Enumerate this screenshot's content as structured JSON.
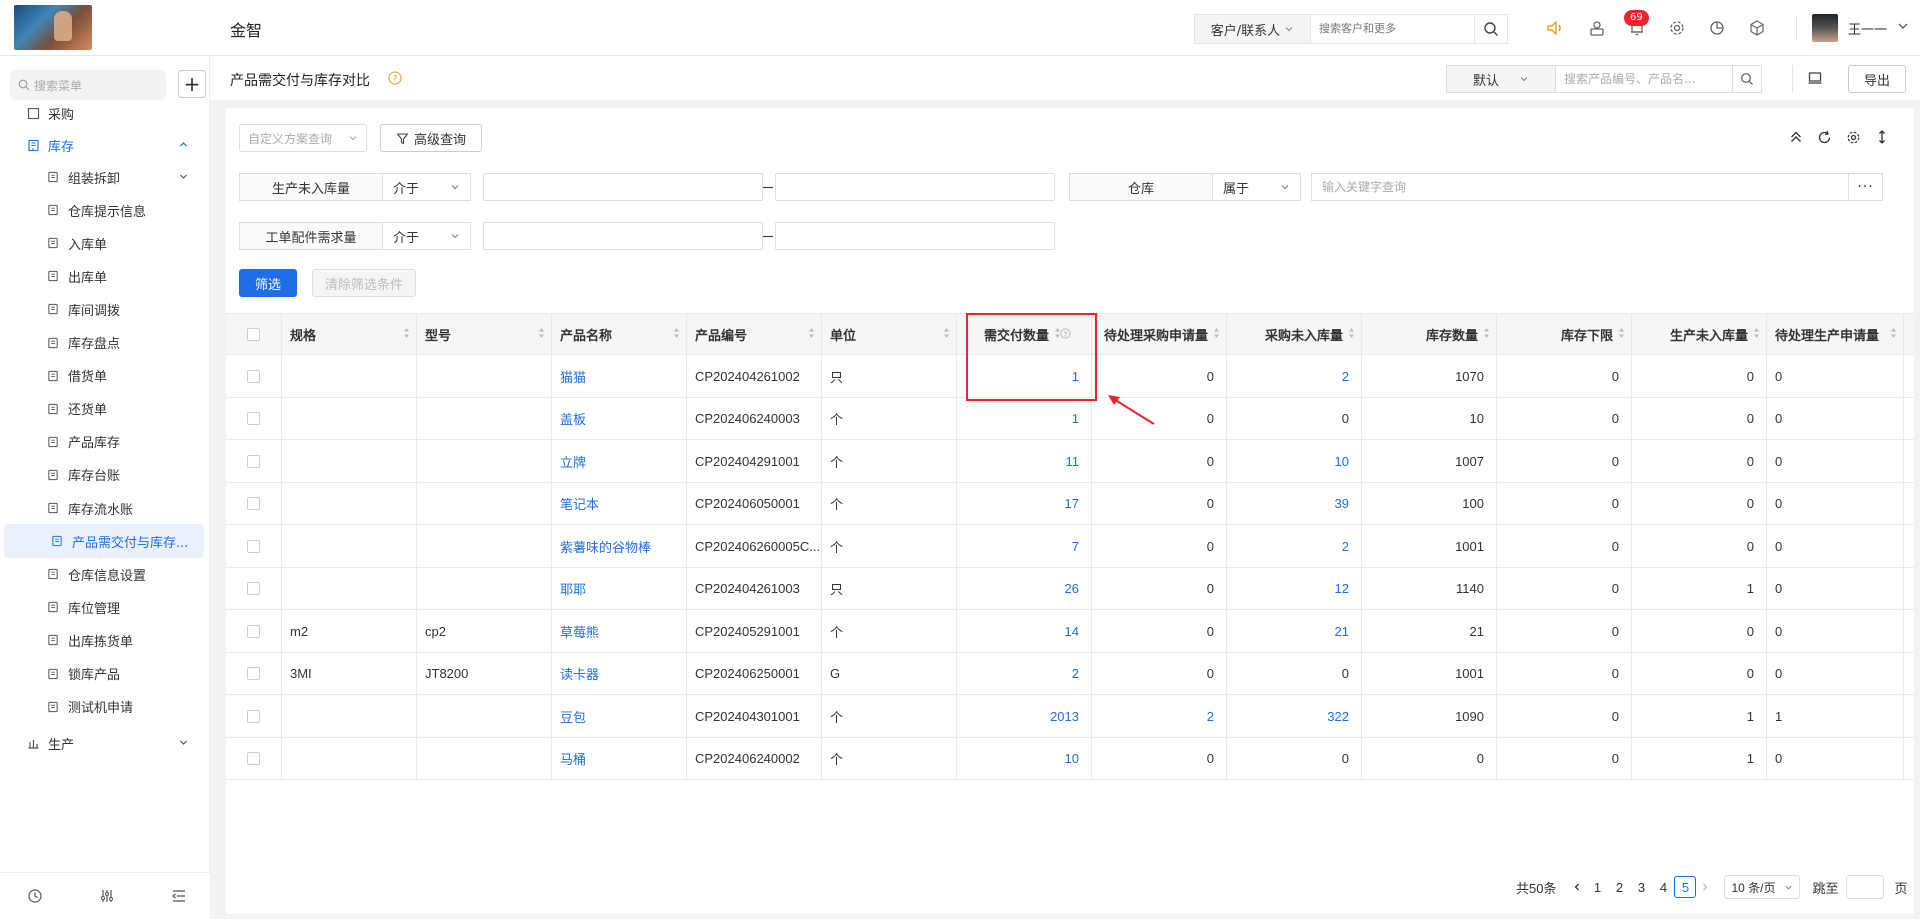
{
  "header": {
    "app_title": "金智",
    "customer_select": "客户/联系人",
    "customer_search_placeholder": "搜索客户和更多",
    "notification_count": "69",
    "user_name": "王一一"
  },
  "sidebar": {
    "search_placeholder": "搜索菜单",
    "partial_top": "采购",
    "section": "库存",
    "items": [
      {
        "label": "组装拆卸",
        "icon": "copy-icon"
      },
      {
        "label": "仓库提示信息",
        "icon": "doc-icon"
      },
      {
        "label": "入库单",
        "icon": "inbox-icon"
      },
      {
        "label": "出库单",
        "icon": "outbox-icon"
      },
      {
        "label": "库间调拨",
        "icon": "transfer-icon"
      },
      {
        "label": "库存盘点",
        "icon": "calculator-icon"
      },
      {
        "label": "借货单",
        "icon": "borrow-icon"
      },
      {
        "label": "还货单",
        "icon": "return-icon"
      },
      {
        "label": "产品库存",
        "icon": "file-icon"
      },
      {
        "label": "库存台账",
        "icon": "ledger-icon"
      },
      {
        "label": "库存流水账",
        "icon": "journal-icon"
      },
      {
        "label": "产品需交付与库存...",
        "icon": "compare-icon"
      },
      {
        "label": "仓库信息设置",
        "icon": "settings-icon"
      },
      {
        "label": "库位管理",
        "icon": "grid-icon"
      },
      {
        "label": "出库拣货单",
        "icon": "pick-icon"
      },
      {
        "label": "锁库产品",
        "icon": "lock-doc-icon"
      },
      {
        "label": "测试机申请",
        "icon": "apply-icon"
      }
    ],
    "next_section": "生产"
  },
  "page": {
    "title": "产品需交付与库存对比",
    "view_select": "默认",
    "search_placeholder": "搜索产品编号、产品名...",
    "export_label": "导出"
  },
  "filters": {
    "scheme_placeholder": "自定义方案查询",
    "advanced_label": "高级查询",
    "f1_label": "生产未入库量",
    "f1_op": "介于",
    "f2_label": "仓库",
    "f2_op": "属于",
    "f2_placeholder": "输入关键字查询",
    "f3_label": "工单配件需求量",
    "f3_op": "介于",
    "filter_button": "筛选",
    "clear_button": "清除筛选条件"
  },
  "table": {
    "columns": [
      "规格",
      "型号",
      "产品名称",
      "产品编号",
      "单位",
      "需交付数量",
      "待处理采购申请量",
      "采购未入库量",
      "库存数量",
      "库存下限",
      "生产未入库量",
      "待处理生产申请量"
    ],
    "rows": [
      {
        "spec": "",
        "model": "",
        "name": "猫猫",
        "code": "CP202404261002",
        "unit": "只",
        "deliver": "1",
        "pending_purchase": "0",
        "purchase_not_in": "2",
        "stock": "1070",
        "stock_min": "0",
        "prod_not_in": "0",
        "pending_prod": "0"
      },
      {
        "spec": "",
        "model": "",
        "name": "盖板",
        "code": "CP202406240003",
        "unit": "个",
        "deliver": "1",
        "pending_purchase": "0",
        "purchase_not_in": "0",
        "stock": "10",
        "stock_min": "0",
        "prod_not_in": "0",
        "pending_prod": "0"
      },
      {
        "spec": "",
        "model": "",
        "name": "立牌",
        "code": "CP202404291001",
        "unit": "个",
        "deliver": "11",
        "pending_purchase": "0",
        "purchase_not_in": "10",
        "stock": "1007",
        "stock_min": "0",
        "prod_not_in": "0",
        "pending_prod": "0"
      },
      {
        "spec": "",
        "model": "",
        "name": "笔记本",
        "code": "CP202406050001",
        "unit": "个",
        "deliver": "17",
        "pending_purchase": "0",
        "purchase_not_in": "39",
        "stock": "100",
        "stock_min": "0",
        "prod_not_in": "0",
        "pending_prod": "0"
      },
      {
        "spec": "",
        "model": "",
        "name": "紫薯味的谷物棒",
        "code": "CP202406260005C...",
        "unit": "个",
        "deliver": "7",
        "pending_purchase": "0",
        "purchase_not_in": "2",
        "stock": "1001",
        "stock_min": "0",
        "prod_not_in": "0",
        "pending_prod": "0"
      },
      {
        "spec": "",
        "model": "",
        "name": "耶耶",
        "code": "CP202404261003",
        "unit": "只",
        "deliver": "26",
        "pending_purchase": "0",
        "purchase_not_in": "12",
        "stock": "1140",
        "stock_min": "0",
        "prod_not_in": "1",
        "pending_prod": "0"
      },
      {
        "spec": "m2",
        "model": "cp2",
        "name": "草莓熊",
        "code": "CP202405291001",
        "unit": "个",
        "deliver": "14",
        "pending_purchase": "0",
        "purchase_not_in": "21",
        "stock": "21",
        "stock_min": "0",
        "prod_not_in": "0",
        "pending_prod": "0"
      },
      {
        "spec": "3MI",
        "model": "JT8200",
        "name": "读卡器",
        "code": "CP202406250001",
        "unit": "G",
        "deliver": "2",
        "pending_purchase": "0",
        "purchase_not_in": "0",
        "stock": "1001",
        "stock_min": "0",
        "prod_not_in": "0",
        "pending_prod": "0"
      },
      {
        "spec": "",
        "model": "",
        "name": "豆包",
        "code": "CP202404301001",
        "unit": "个",
        "deliver": "2013",
        "pending_purchase": "2",
        "purchase_not_in": "322",
        "stock": "1090",
        "stock_min": "0",
        "prod_not_in": "1",
        "pending_prod": "1"
      },
      {
        "spec": "",
        "model": "",
        "name": "马桶",
        "code": "CP202406240002",
        "unit": "个",
        "deliver": "10",
        "pending_purchase": "0",
        "purchase_not_in": "0",
        "stock": "0",
        "stock_min": "0",
        "prod_not_in": "1",
        "pending_prod": "0"
      }
    ]
  },
  "pagination": {
    "total": "共50条",
    "pages": [
      "1",
      "2",
      "3",
      "4",
      "5"
    ],
    "current": "5",
    "page_size": "10 条/页",
    "jump_label": "跳至",
    "page_suffix": "页"
  },
  "colors": {
    "accent": "#1e6fe5",
    "highlight": "#e5262c",
    "badge": "#f5222d"
  }
}
